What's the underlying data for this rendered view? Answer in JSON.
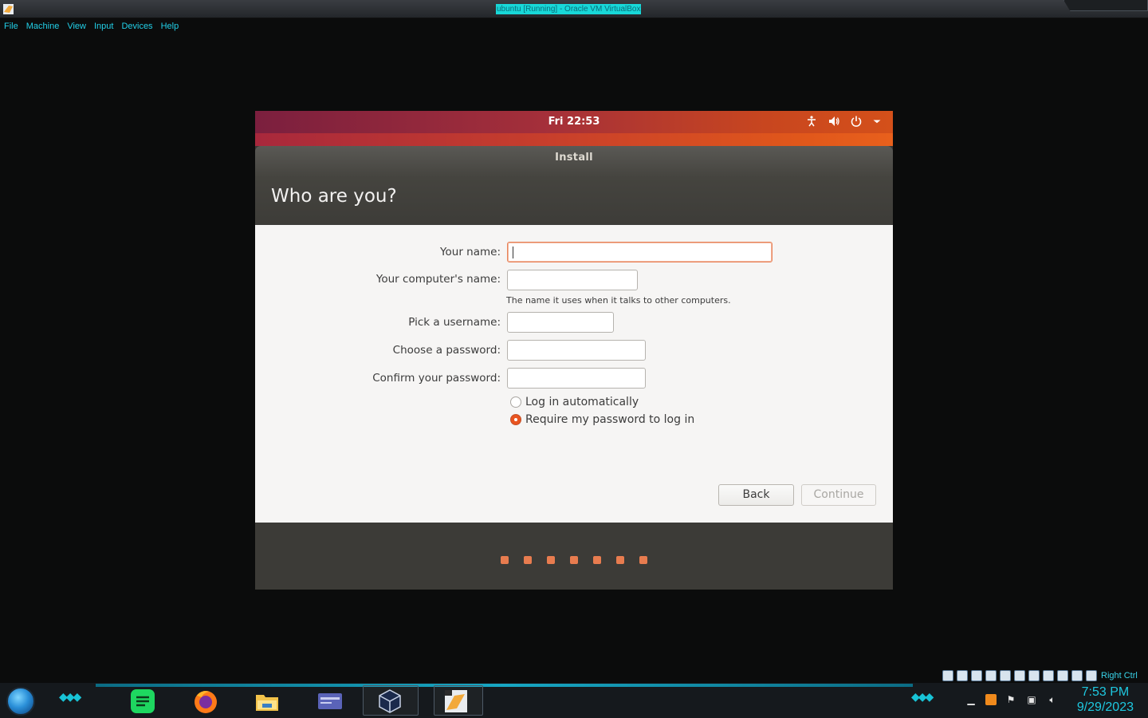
{
  "host": {
    "window_title": "ubuntu [Running] - Oracle VM VirtualBox",
    "menu": [
      "File",
      "Machine",
      "View",
      "Input",
      "Devices",
      "Help"
    ]
  },
  "gnome": {
    "clock": "Fri 22:53",
    "tray_icons": [
      "accessibility-icon",
      "volume-icon",
      "power-icon",
      "dropdown-arrow-icon"
    ]
  },
  "installer": {
    "window_title": "Install",
    "heading": "Who are you?",
    "fields": {
      "name_label": "Your name:",
      "name_value": "",
      "computer_label": "Your computer's name:",
      "computer_value": "",
      "computer_hint": "The name it uses when it talks to other computers.",
      "username_label": "Pick a username:",
      "username_value": "",
      "password_label": "Choose a password:",
      "password_value": "",
      "confirm_label": "Confirm your password:",
      "confirm_value": ""
    },
    "login_options": [
      {
        "label": "Log in automatically",
        "selected": false
      },
      {
        "label": "Require my password to log in",
        "selected": true
      }
    ],
    "buttons": {
      "back": "Back",
      "continue": "Continue"
    },
    "progress_steps": 7,
    "accent_color": "#E95420"
  },
  "taskbar": {
    "apps": [
      "spotify-icon",
      "firefox-icon",
      "file-explorer-icon",
      "browser-window-icon",
      "virtualbox-icon",
      "virtualbox-vm-icon"
    ],
    "host_key_label": "Right Ctrl",
    "time": "7:53 PM",
    "date": "9/29/2023"
  }
}
